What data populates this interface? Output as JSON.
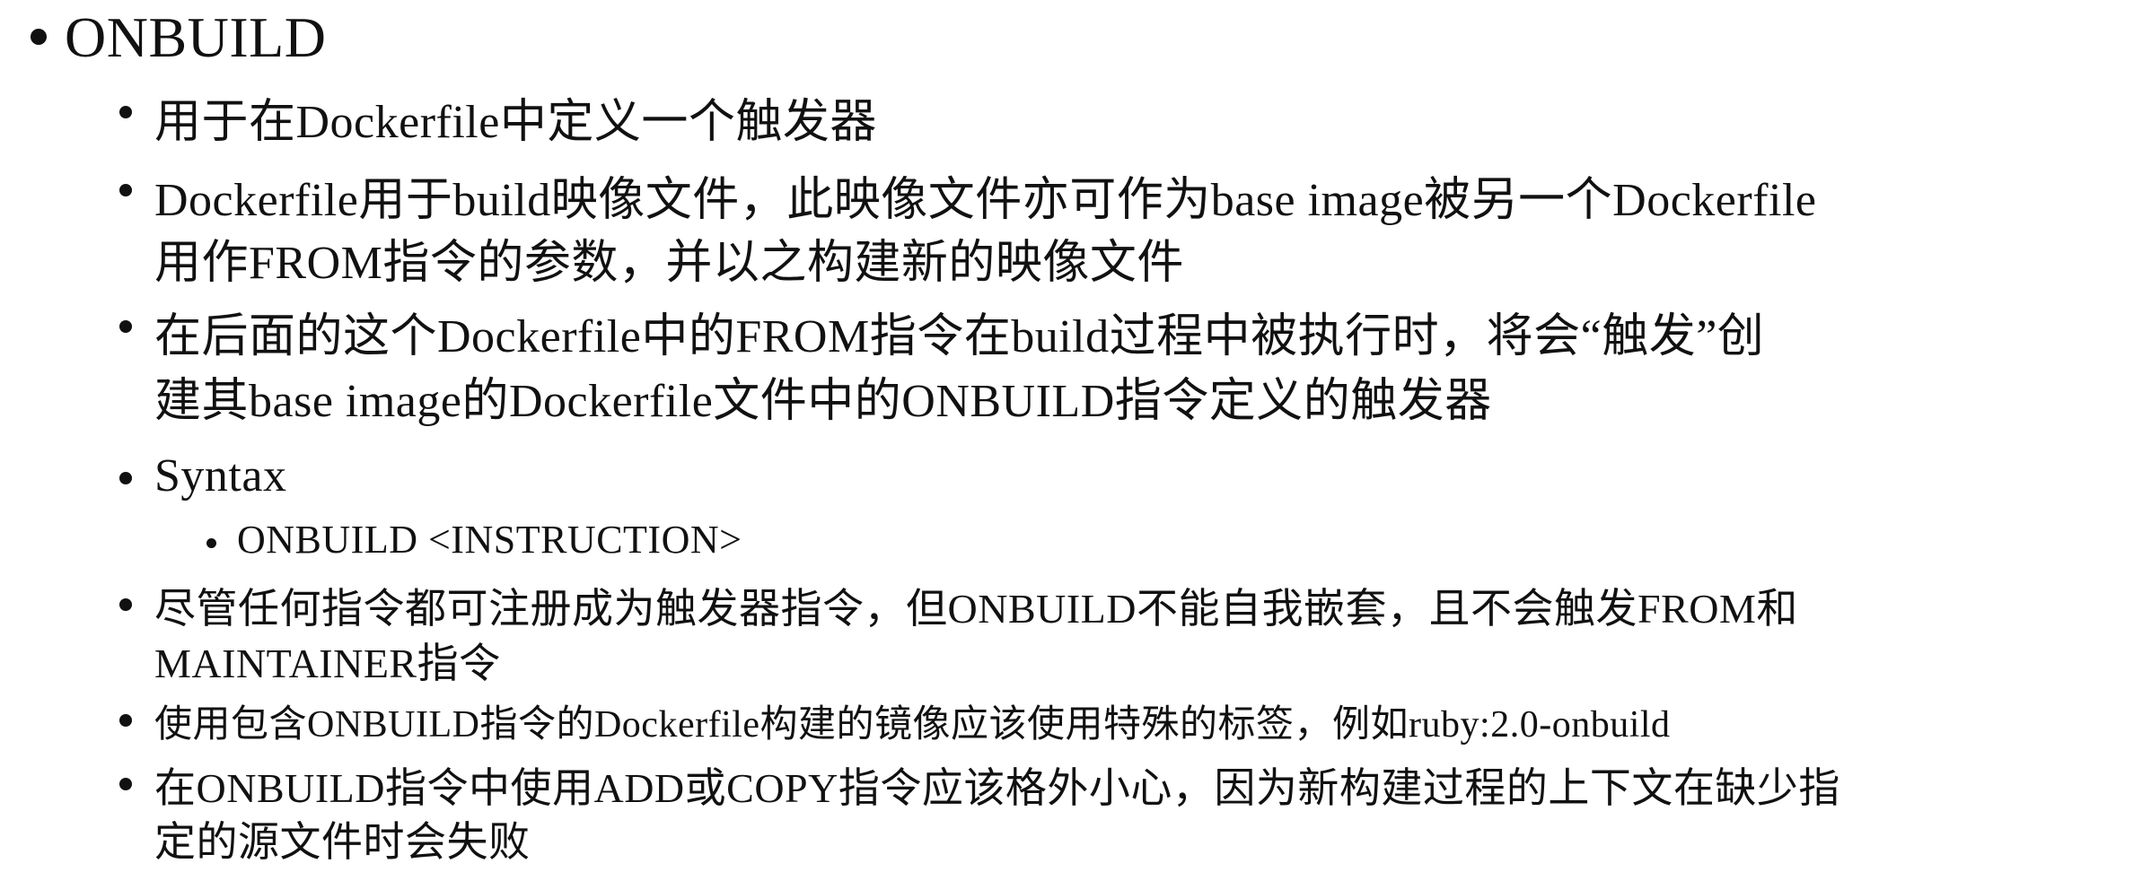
{
  "title": "ONBUILD",
  "items": [
    {
      "lines": [
        "用于在Dockerfile中定义一个触发器"
      ]
    },
    {
      "lines": [
        "Dockerfile用于build映像文件，此映像文件亦可作为base image被另一个Dockerfile",
        "用作FROM指令的参数，并以之构建新的映像文件"
      ]
    },
    {
      "lines": [
        "在后面的这个Dockerfile中的FROM指令在build过程中被执行时，将会“触发”创",
        "建其base image的Dockerfile文件中的ONBUILD指令定义的触发器"
      ]
    },
    {
      "lines": [
        "Syntax"
      ],
      "sub": [
        "ONBUILD <INSTRUCTION>"
      ]
    },
    {
      "lines": [
        "尽管任何指令都可注册成为触发器指令，但ONBUILD不能自我嵌套，且不会触发FROM和",
        "MAINTAINER指令"
      ]
    },
    {
      "lines": [
        "使用包含ONBUILD指令的Dockerfile构建的镜像应该使用特殊的标签，例如ruby:2.0-onbuild"
      ]
    },
    {
      "lines": [
        "在ONBUILD指令中使用ADD或COPY指令应该格外小心，因为新构建过程的上下文在缺少指",
        "定的源文件时会失败"
      ]
    }
  ]
}
